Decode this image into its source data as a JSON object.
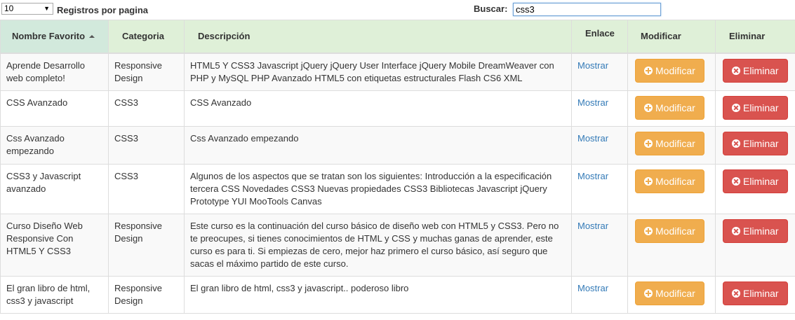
{
  "length_menu": {
    "selected": "10",
    "label": "Registros por pagina"
  },
  "search": {
    "label": "Buscar:",
    "value": "css3"
  },
  "columns": {
    "nombre": "Nombre Favorito",
    "categoria": "Categoria",
    "descripcion": "Descripción",
    "enlace": "Enlace",
    "modificar": "Modificar",
    "eliminar": "Eliminar"
  },
  "buttons": {
    "link_label": "Mostrar",
    "modify_label": "Modificar",
    "delete_label": "Eliminar"
  },
  "rows": [
    {
      "nombre": "Aprende Desarrollo web completo!",
      "categoria": "Responsive Design",
      "descripcion": "HTML5 Y CSS3 Javascript jQuery jQuery User Interface jQuery Mobile DreamWeaver con PHP y MySQL PHP Avanzado HTML5 con etiquetas estructurales Flash CS6 XML"
    },
    {
      "nombre": "CSS Avanzado",
      "categoria": "CSS3",
      "descripcion": "CSS Avanzado"
    },
    {
      "nombre": "Css Avanzado empezando",
      "categoria": "CSS3",
      "descripcion": "Css Avanzado empezando"
    },
    {
      "nombre": "CSS3 y Javascript avanzado",
      "categoria": "CSS3",
      "descripcion": "Algunos de los aspectos que se tratan son los siguientes: Introducción a la especificación tercera CSS Novedades CSS3 Nuevas propiedades CSS3 Bibliotecas Javascript jQuery Prototype YUI MooTools Canvas"
    },
    {
      "nombre": "Curso Diseño Web Responsive Con HTML5 Y CSS3",
      "categoria": "Responsive Design",
      "descripcion": "Este curso es la continuación del curso básico de diseño web con HTML5 y CSS3. Pero no te preocupes, si tienes conocimientos de HTML y CSS y muchas ganas de aprender, este curso es para ti. Si empiezas de cero, mejor haz primero el curso básico, así seguro que sacas el máximo partido de este curso."
    },
    {
      "nombre": "El gran libro de html, css3 y javascript",
      "categoria": "Responsive Design",
      "descripcion": "El gran libro de html, css3 y javascript.. poderoso libro"
    }
  ]
}
